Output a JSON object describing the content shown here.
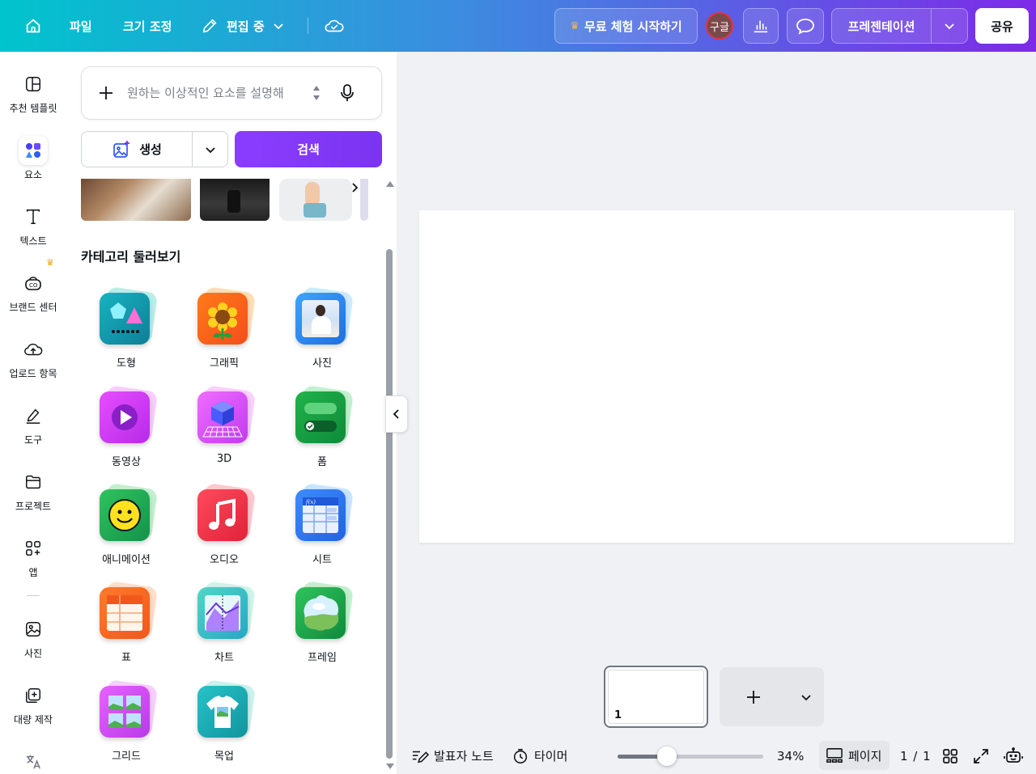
{
  "topbar": {
    "file": "파일",
    "resize": "크기 조정",
    "editing": "편집 중",
    "trial": "무료 체험 시작하기",
    "avatar": "구글",
    "present": "프레젠테이션",
    "share": "공유",
    "icons": [
      "home-icon",
      "pencil-icon",
      "cloud-check-icon",
      "crown-icon",
      "bar-chart-icon",
      "comment-icon",
      "chevron-down-icon"
    ]
  },
  "rail": {
    "items": [
      {
        "label": "추천 템플릿",
        "icon": "template-icon"
      },
      {
        "label": "요소",
        "icon": "elements-icon",
        "active": true
      },
      {
        "label": "텍스트",
        "icon": "text-icon"
      },
      {
        "label": "브랜드 센터",
        "icon": "brand-icon"
      },
      {
        "label": "업로드 항목",
        "icon": "upload-icon"
      },
      {
        "label": "도구",
        "icon": "draw-icon"
      },
      {
        "label": "프로젝트",
        "icon": "folder-icon"
      },
      {
        "label": "앱",
        "icon": "apps-icon"
      },
      {
        "label": "사진",
        "icon": "photo-icon"
      },
      {
        "label": "대량 제작",
        "icon": "bulk-create-icon"
      }
    ]
  },
  "panel": {
    "search_placeholder": "원하는 이상적인 요소를 설명해",
    "generate": "생성",
    "search": "검색",
    "category_title": "카테고리 둘러보기",
    "categories": [
      {
        "label": "도형"
      },
      {
        "label": "그래픽"
      },
      {
        "label": "사진"
      },
      {
        "label": "동영상"
      },
      {
        "label": "3D"
      },
      {
        "label": "폼"
      },
      {
        "label": "애니메이션"
      },
      {
        "label": "오디오"
      },
      {
        "label": "시트"
      },
      {
        "label": "표"
      },
      {
        "label": "차트"
      },
      {
        "label": "프레임"
      },
      {
        "label": "그리드"
      },
      {
        "label": "목업"
      }
    ]
  },
  "canvas": {
    "page_number": "1"
  },
  "bottom": {
    "notes": "발표자 노트",
    "timer": "타이머",
    "zoom": "34%",
    "zoom_level": 0.34,
    "pages": "페이지",
    "page_count": "1 / 1"
  },
  "colors": {
    "brand_gradient_start": "#00c4cc",
    "brand_gradient_end": "#7d2ae8",
    "search_button": "#8b3dff",
    "crown": "#f2a400"
  }
}
